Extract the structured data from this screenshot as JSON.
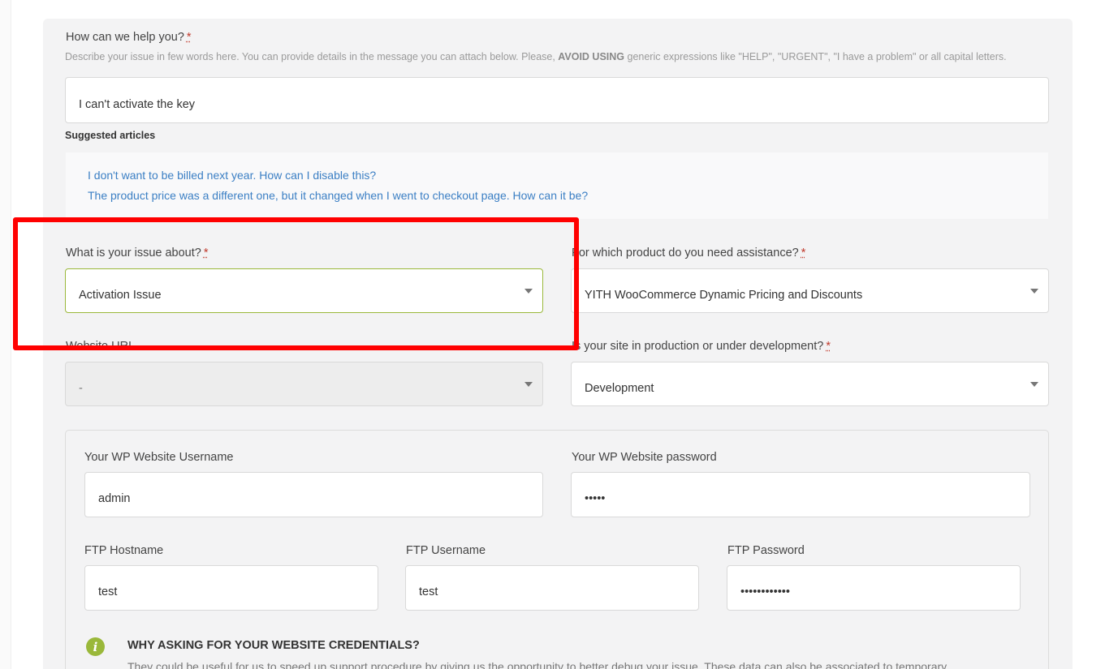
{
  "help_section": {
    "label": "How can we help you?",
    "required_mark": "*",
    "help_prefix": "Describe your issue in few words here. You can provide details in the message you can attach below. Please, ",
    "help_bold": "AVOID USING",
    "help_suffix": " generic expressions like \"HELP\", \"URGENT\", \"I have a problem\" or all capital letters.",
    "subject_value": "I can't activate the key"
  },
  "suggested": {
    "title": "Suggested articles",
    "articles": [
      "I don't want to be billed next year. How can I disable this?",
      "The product price was a different one, but it changed when I went to checkout page. How can it be?"
    ]
  },
  "issue": {
    "label": "What is your issue about?",
    "required_mark": "*",
    "value": "Activation Issue"
  },
  "product": {
    "label": "For which product do you need assistance?",
    "required_mark": "*",
    "value": "YITH WooCommerce Dynamic Pricing and Discounts"
  },
  "website": {
    "label": "Website URL",
    "value": "-"
  },
  "site_status": {
    "label": "Is your site in production or under development?",
    "required_mark": "*",
    "value": "Development"
  },
  "credentials": {
    "wp_username_label": "Your WP Website Username",
    "wp_username_value": "admin",
    "wp_password_label": "Your WP Website password",
    "wp_password_value": "•••••",
    "ftp_host_label": "FTP Hostname",
    "ftp_host_value": "test",
    "ftp_user_label": "FTP Username",
    "ftp_user_value": "test",
    "ftp_pass_label": "FTP Password",
    "ftp_pass_value": "••••••••••••",
    "info_icon": "info-icon",
    "info_title": "WHY ASKING FOR YOUR WEBSITE CREDENTIALS?",
    "info_text": "They could be useful for us to speed up support procedure by giving us the opportunity to better debug your issue. These data can also be associated to temporary"
  },
  "colors": {
    "accent_green": "#9ab83a",
    "link_blue": "#3b7fc4",
    "highlight_red": "#ff0000",
    "required_red": "#c0392b"
  }
}
